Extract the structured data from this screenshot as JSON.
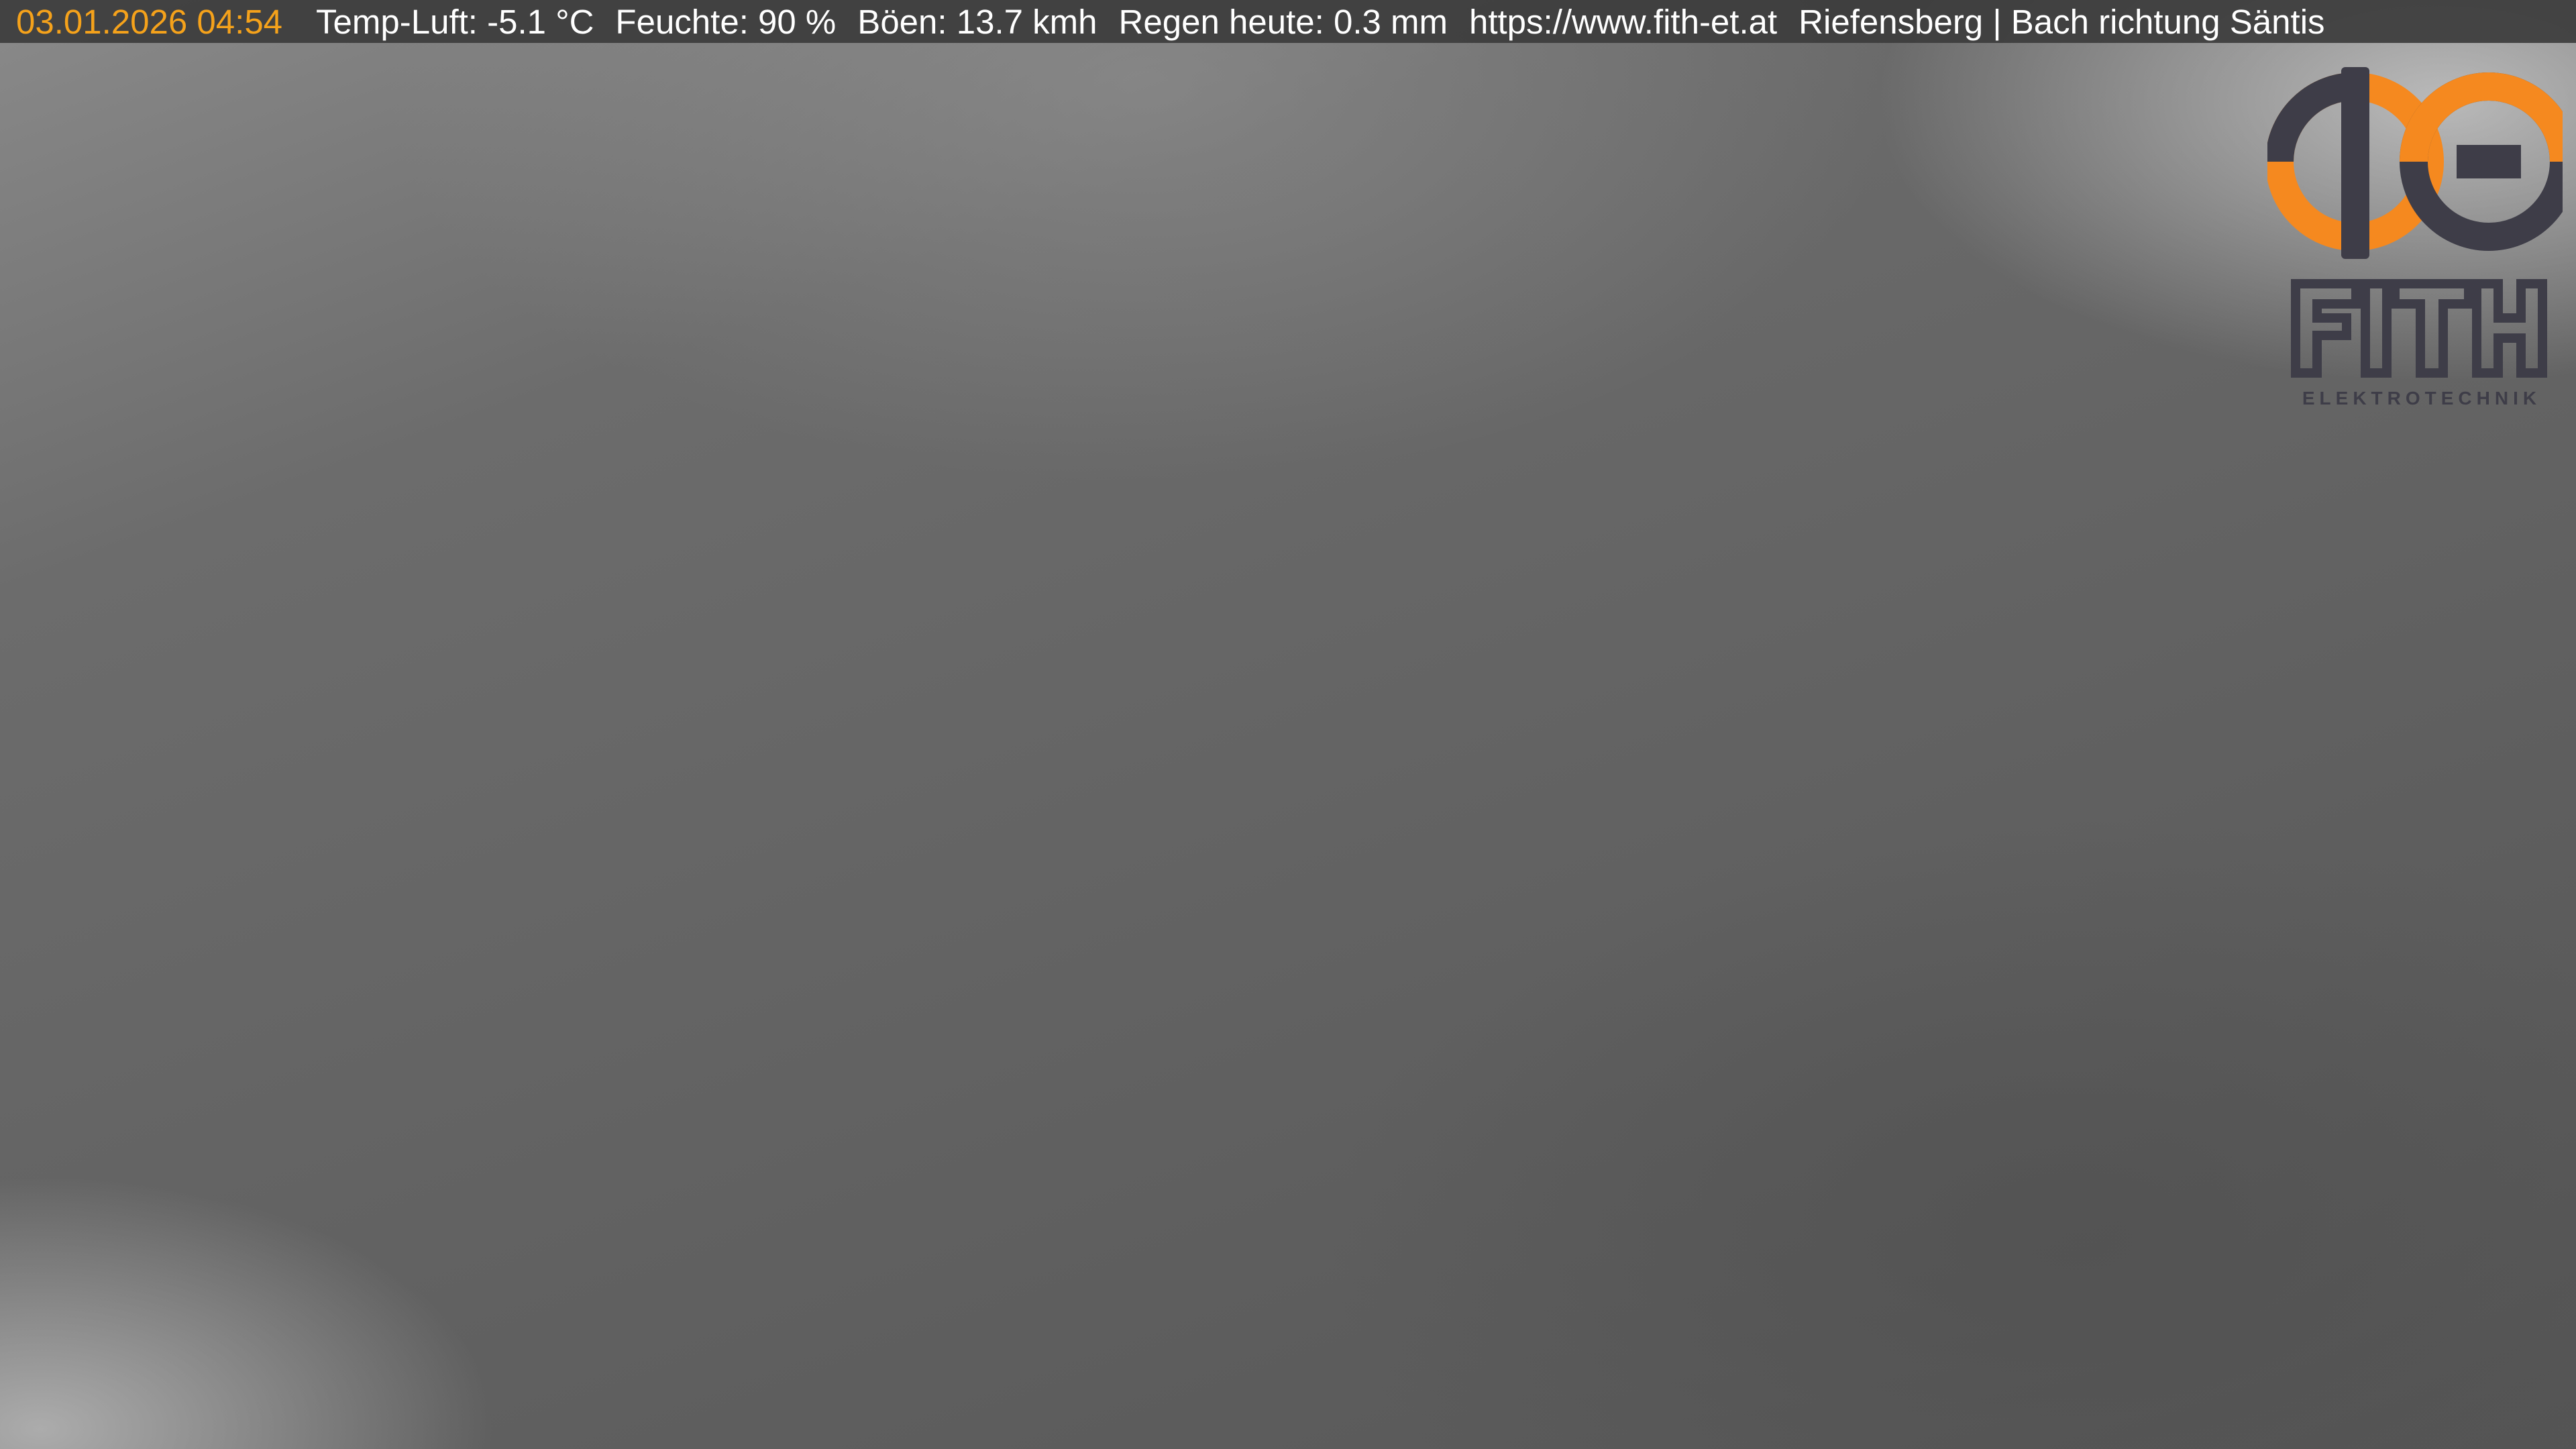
{
  "overlay": {
    "timestamp": "03.01.2026 04:54",
    "temp": "Temp-Luft: -5.1 °C",
    "humidity": "Feuchte: 90 %",
    "gusts": "Böen: 13.7 kmh",
    "rain": "Regen heute: 0.3 mm",
    "url": "https://www.fith-et.at",
    "location": "Riefensberg | Bach richtung Säntis"
  },
  "logo": {
    "brand": "FITH",
    "subtitle": "ELEKTROTECHNIK"
  },
  "colors": {
    "accent_orange": "#f5891f",
    "logo_dark": "#3e3d48",
    "timestamp": "#f5a21b"
  },
  "icons": {
    "logo_symbol": "phi-theta-logo-icon"
  }
}
